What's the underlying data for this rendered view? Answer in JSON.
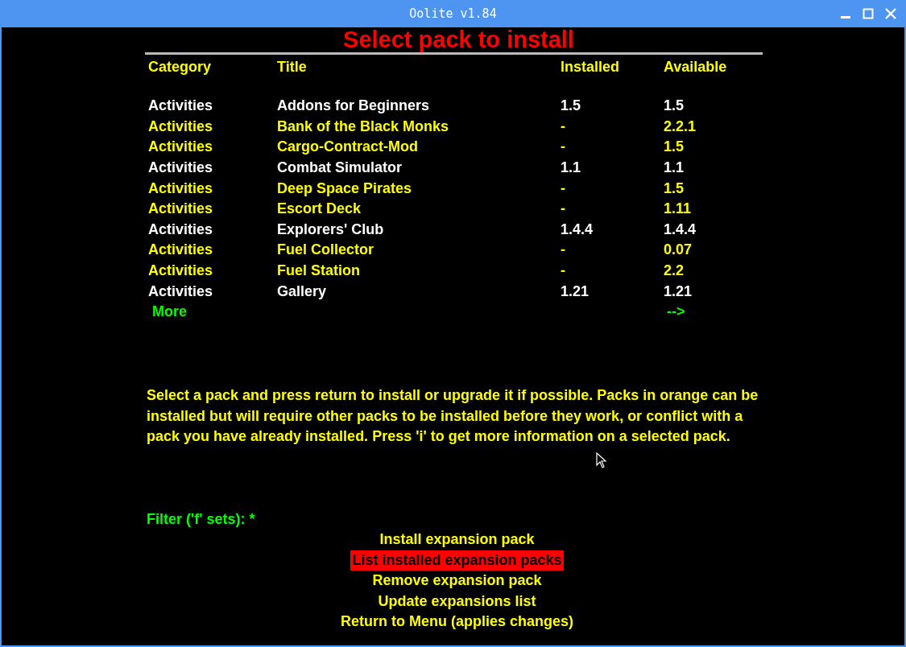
{
  "window": {
    "title": "Oolite v1.84"
  },
  "heading": "Select pack to install",
  "table": {
    "columns": [
      "Category",
      "Title",
      "Installed",
      "Available"
    ],
    "rows": [
      {
        "installed": true,
        "cells": [
          "Activities",
          "Addons for Beginners",
          "1.5",
          "1.5"
        ]
      },
      {
        "installed": false,
        "cells": [
          "Activities",
          "Bank of the Black Monks",
          "-",
          "2.2.1"
        ]
      },
      {
        "installed": false,
        "cells": [
          "Activities",
          "Cargo-Contract-Mod",
          "-",
          "1.5"
        ]
      },
      {
        "installed": true,
        "cells": [
          "Activities",
          "Combat Simulator",
          "1.1",
          "1.1"
        ]
      },
      {
        "installed": false,
        "cells": [
          "Activities",
          "Deep Space Pirates",
          "-",
          "1.5"
        ]
      },
      {
        "installed": false,
        "cells": [
          "Activities",
          "Escort Deck",
          "-",
          "1.11"
        ]
      },
      {
        "installed": true,
        "cells": [
          "Activities",
          "Explorers' Club",
          "1.4.4",
          "1.4.4"
        ]
      },
      {
        "installed": false,
        "cells": [
          "Activities",
          "Fuel Collector",
          "-",
          "0.07"
        ]
      },
      {
        "installed": false,
        "cells": [
          "Activities",
          "Fuel Station",
          "-",
          "2.2"
        ]
      },
      {
        "installed": true,
        "cells": [
          "Activities",
          "Gallery",
          "1.21",
          "1.21"
        ]
      }
    ],
    "more": {
      "label": "More",
      "arrow": "-->"
    }
  },
  "help_text": "Select a pack and press return to install or upgrade it if possible. Packs in orange can be installed but will require other packs to be installed before they work, or conflict with a pack you have already installed. Press 'i' to get more information on a selected pack.",
  "filter": "Filter ('f' sets): *",
  "menu": [
    {
      "label": "Install expansion pack",
      "selected": false
    },
    {
      "label": "List installed expansion packs",
      "selected": true
    },
    {
      "label": "Remove expansion pack",
      "selected": false
    },
    {
      "label": "Update expansions list",
      "selected": false
    },
    {
      "label": "Return to Menu (applies changes)",
      "selected": false
    }
  ]
}
